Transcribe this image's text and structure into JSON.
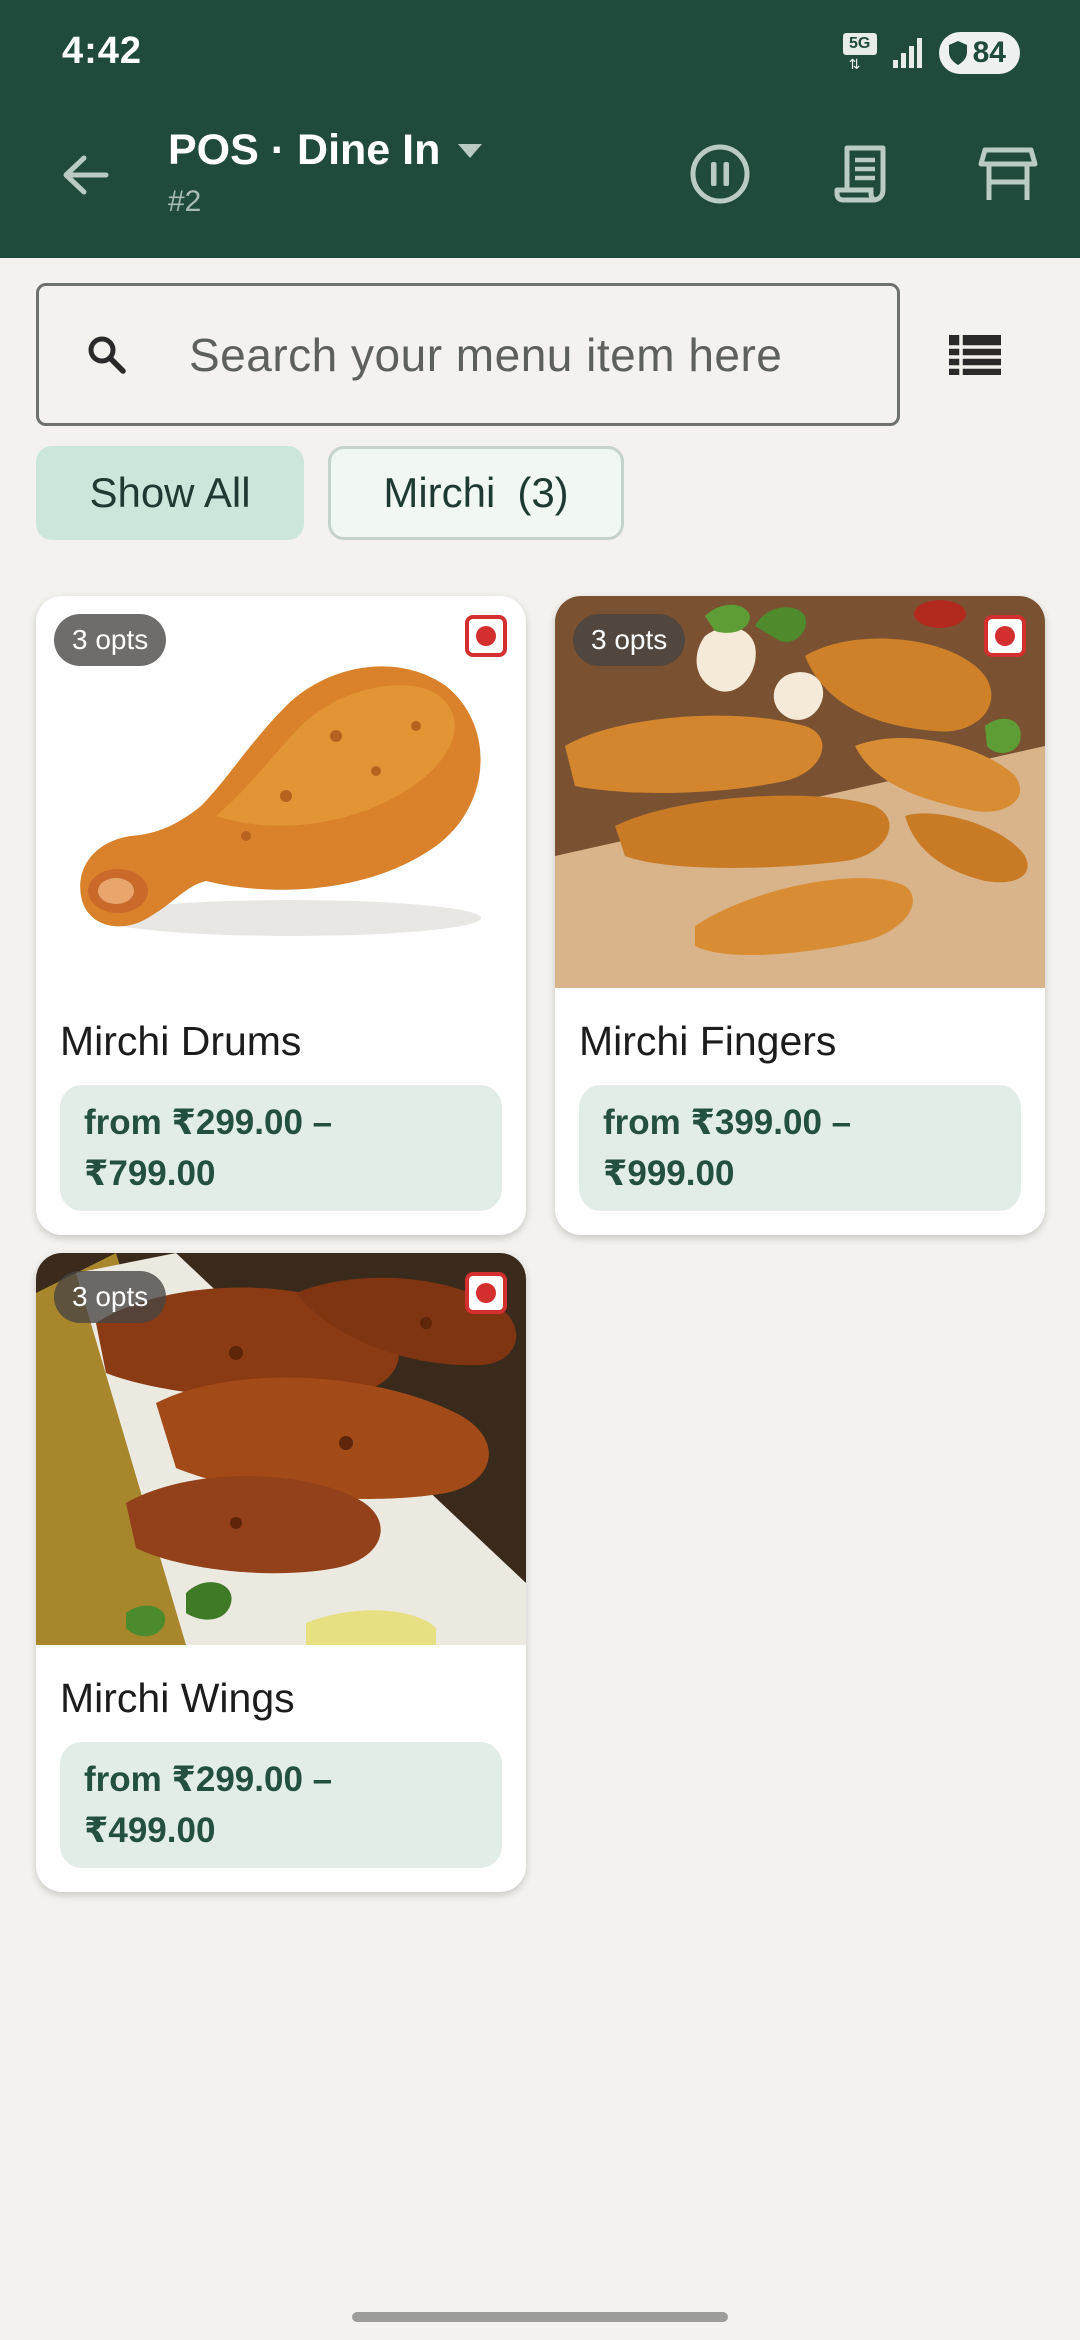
{
  "status_bar": {
    "time": "4:42",
    "network": "5G",
    "battery": "84"
  },
  "app_bar": {
    "title": "POS · Dine In",
    "subtitle": "#2"
  },
  "search": {
    "placeholder": "Search your menu item here"
  },
  "filters": {
    "show_all": "Show All",
    "category": "Mirchi",
    "category_count": "(3)"
  },
  "items": [
    {
      "opts": "3 opts",
      "name": "Mirchi Drums",
      "price_line1": "from ₹299.00 –",
      "price_line2": "₹799.00"
    },
    {
      "opts": "3 opts",
      "name": "Mirchi Fingers",
      "price_line1": "from ₹399.00 –",
      "price_line2": "₹999.00"
    },
    {
      "opts": "3 opts",
      "name": "Mirchi Wings",
      "price_line1": "from ₹299.00 –",
      "price_line2": "₹499.00"
    }
  ],
  "colors": {
    "app_bar": "#1f4a3c",
    "background": "#f3f2ee",
    "chip_selected": "#cce6dc",
    "price_bg": "#e3ede8",
    "non_veg_badge": "#d32f2f"
  }
}
